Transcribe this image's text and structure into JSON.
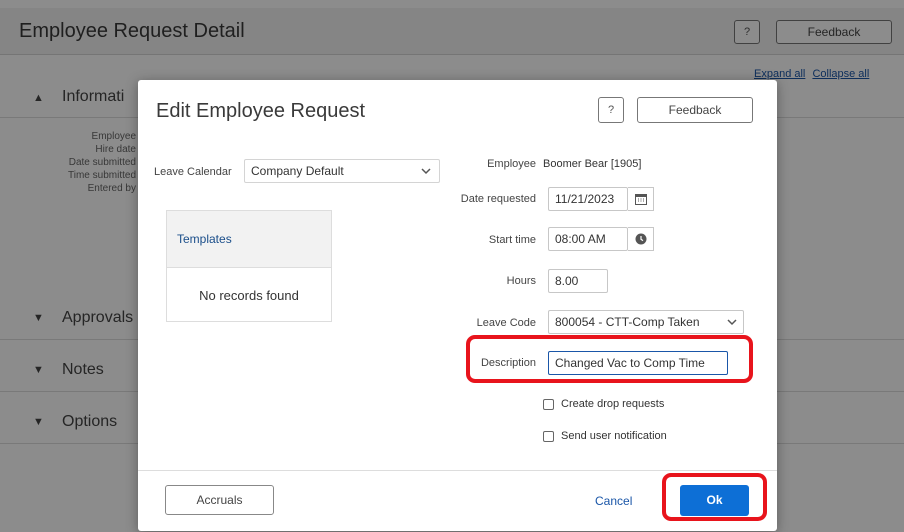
{
  "background": {
    "title": "Employee Request Detail",
    "help_label": "?",
    "feedback_label": "Feedback",
    "expand_all": "Expand all",
    "collapse_all": "Collapse all",
    "sections": {
      "information": "Informati",
      "approvals": "Approvals",
      "notes": "Notes",
      "options": "Options"
    },
    "info_rows": [
      "Employee",
      "Hire date",
      "Date submitted",
      "Time submitted",
      "Entered by"
    ]
  },
  "modal": {
    "title": "Edit Employee Request",
    "help_label": "?",
    "feedback_label": "Feedback",
    "leave_calendar_label": "Leave Calendar",
    "leave_calendar_value": "Company Default",
    "templates_title": "Templates",
    "templates_empty": "No records found",
    "employee_label": "Employee",
    "employee_value": "Boomer Bear [1905]",
    "date_requested_label": "Date requested",
    "date_requested_value": "11/21/2023",
    "start_time_label": "Start time",
    "start_time_value": "08:00 AM",
    "hours_label": "Hours",
    "hours_value": "8.00",
    "leave_code_label": "Leave Code",
    "leave_code_value": "800054 - CTT-Comp Taken",
    "description_label": "Description",
    "description_value": "Changed Vac to Comp Time",
    "create_drop_requests": "Create drop requests",
    "send_user_notification": "Send user notification",
    "accruals_label": "Accruals",
    "cancel_label": "Cancel",
    "ok_label": "Ok"
  },
  "colors": {
    "primary": "#0d6fd6",
    "highlight": "#e8141c",
    "link": "#1a56a8"
  }
}
